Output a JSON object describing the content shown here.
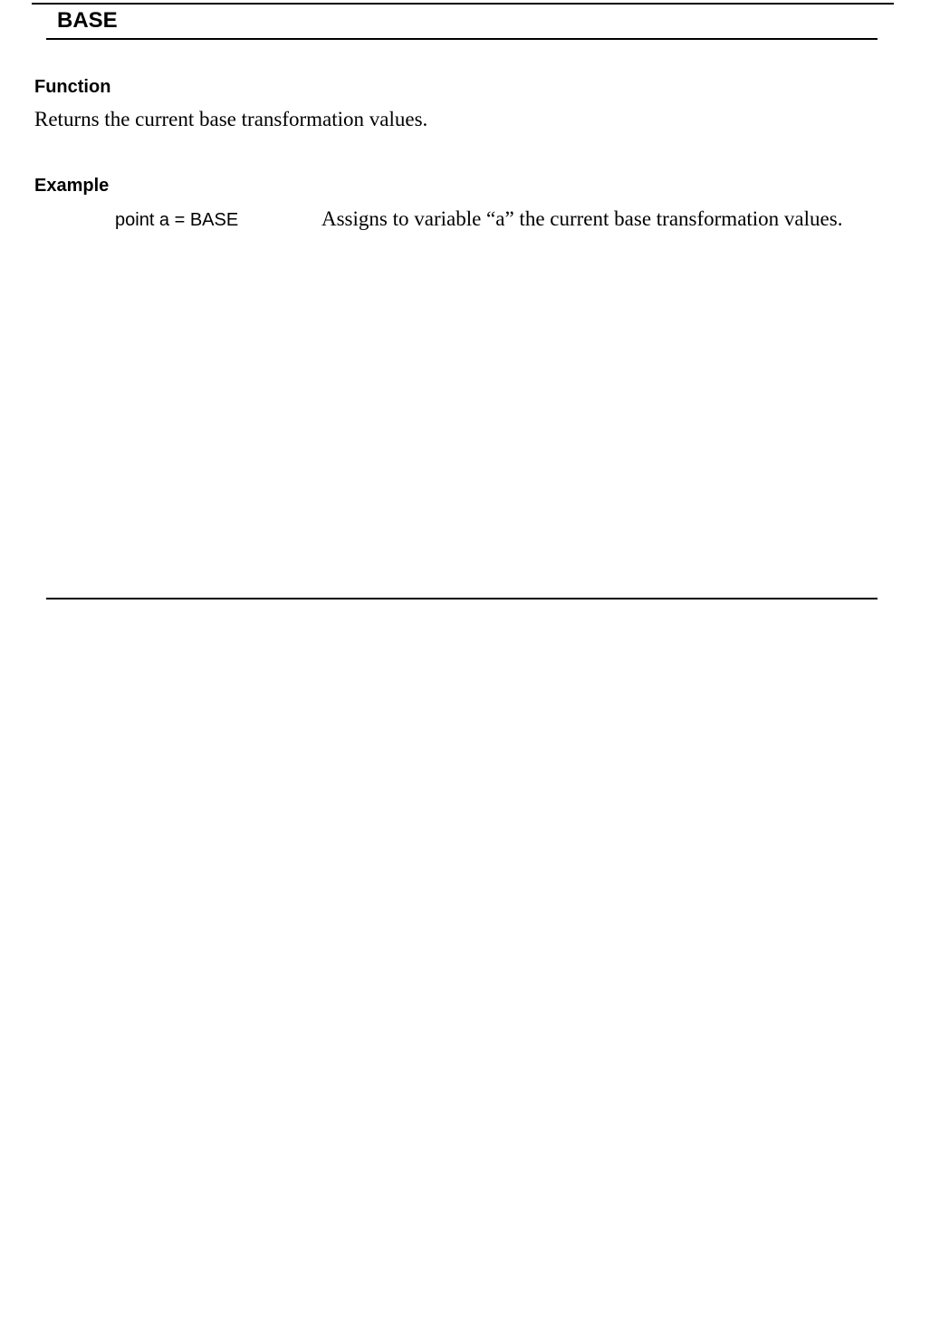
{
  "page": {
    "title": "BASE"
  },
  "function_section": {
    "heading": "Function",
    "description": "Returns the current base transformation values."
  },
  "example_section": {
    "heading": "Example",
    "code": "point a = BASE",
    "description": "Assigns to variable “a” the current base transformation values."
  }
}
